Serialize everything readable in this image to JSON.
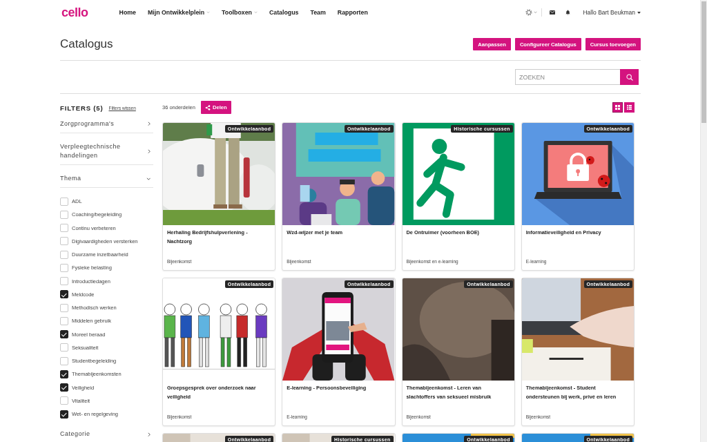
{
  "header": {
    "logo": "cello",
    "nav": [
      {
        "label": "Home",
        "dropdown": false
      },
      {
        "label": "Mijn Ontwikkelplein",
        "dropdown": true
      },
      {
        "label": "Toolboxen",
        "dropdown": true
      },
      {
        "label": "Catalogus",
        "dropdown": false
      },
      {
        "label": "Team",
        "dropdown": false
      },
      {
        "label": "Rapporten",
        "dropdown": false
      }
    ],
    "user": "Hallo Bart Beukman"
  },
  "page": {
    "title": "Catalogus",
    "actions": [
      "Aanpassen",
      "Configureer Catalogus",
      "Cursus toevoegen"
    ]
  },
  "search": {
    "placeholder": "ZOEKEN"
  },
  "filters": {
    "title": "FILTERS (5)",
    "clear": "Filters wissen",
    "groups": [
      {
        "label": "Zorgprogramma's",
        "expanded": false
      },
      {
        "label": "Verpleegtechnische handelingen",
        "expanded": false
      },
      {
        "label": "Thema",
        "expanded": true,
        "options": [
          {
            "label": "ADL",
            "checked": false
          },
          {
            "label": "Coaching/begeleiding",
            "checked": false
          },
          {
            "label": "Continu verbeteren",
            "checked": false
          },
          {
            "label": "Digivaardigheden versterken",
            "checked": false
          },
          {
            "label": "Duurzame inzetbaarheid",
            "checked": false
          },
          {
            "label": "Fysieke belasting",
            "checked": false
          },
          {
            "label": "Introductiedagen",
            "checked": false
          },
          {
            "label": "Meldcode",
            "checked": true
          },
          {
            "label": "Methodisch werken",
            "checked": false
          },
          {
            "label": "Middelen gebruik",
            "checked": false
          },
          {
            "label": "Moreel beraad",
            "checked": true
          },
          {
            "label": "Seksualiteit",
            "checked": false
          },
          {
            "label": "Studentbegeleiding",
            "checked": false
          },
          {
            "label": "Themabijeenkomsten",
            "checked": true
          },
          {
            "label": "Veiligheid",
            "checked": true
          },
          {
            "label": "Vitaliteit",
            "checked": false
          },
          {
            "label": "Wet- en regelgeving",
            "checked": true
          }
        ]
      },
      {
        "label": "Categorie",
        "expanded": false
      }
    ]
  },
  "results": {
    "count": "36 onderdelen",
    "share": "Delen",
    "views": [
      {
        "kind": "grid",
        "selected": true
      },
      {
        "kind": "list",
        "selected": false
      }
    ]
  },
  "cards": [
    {
      "badge": "Ontwikkelaanbod",
      "kind": "smoke-photo",
      "title": "Herhaling Bedrijfshulpverlening - Nachtzorg",
      "format": "Bijeenkomst"
    },
    {
      "badge": "Ontwikkelaanbod",
      "kind": "poster",
      "title": "Wzd-wijzer met je team",
      "format": "Bijeenkomst"
    },
    {
      "badge": "Historische cursussen",
      "kind": "exit-sign",
      "title": "De Ontruimer (voorheen BOE)",
      "format": "Bijeenkomst en e-learning"
    },
    {
      "badge": "Ontwikkelaanbod",
      "kind": "laptop",
      "title": "Informatieveiligheid en Privacy",
      "format": "E-learning"
    },
    {
      "badge": "Ontwikkelaanbod",
      "kind": "people",
      "title": "Groepsgesprek over onderzoek naar veiligheid",
      "format": "Bijeenkomst"
    },
    {
      "badge": "Ontwikkelaanbod",
      "kind": "phone",
      "title": "E-learning - Persoonsbeveiliging",
      "format": "E-learning"
    },
    {
      "badge": "Ontwikkelaanbod",
      "kind": "dark-photo",
      "title": "Themabijeenkomst - Leren van slachtoffers van seksueel misbruik",
      "format": "Bijeenkomst"
    },
    {
      "badge": "Ontwikkelaanbod",
      "kind": "desk-photo",
      "title": "Themabijeenkomst - Student ondersteunen bij werk, privé en leren",
      "format": "Bijeenkomst"
    },
    {
      "badge": "Ontwikkelaanbod",
      "kind": "light-photo"
    },
    {
      "badge": "Historische cursussen",
      "kind": "light-photo"
    },
    {
      "badge": "Ontwikkelaanbod",
      "kind": "blue-photo"
    },
    {
      "badge": "Ontwikkelaanbod",
      "kind": "blue-photo"
    }
  ]
}
